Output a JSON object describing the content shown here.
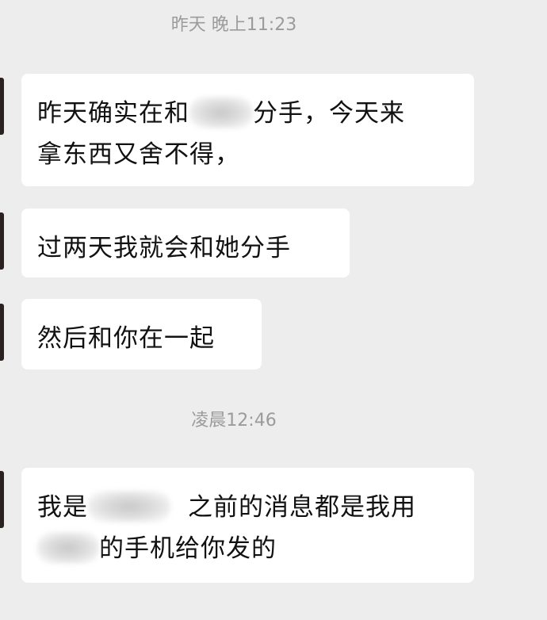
{
  "chat": {
    "time_yesterday": "昨天 晚上11:23",
    "time_early_morning": "凌晨12:46",
    "messages": [
      {
        "line1_before": "昨天确实在和",
        "line1_after": "分手，今天来",
        "line2": "拿东西又舍不得，"
      },
      {
        "text": "过两天我就会和她分手"
      },
      {
        "text": "然后和你在一起"
      },
      {
        "line1_before": "我是",
        "line1_after": "之前的消息都是我用",
        "line2_after": "的手机给你发的"
      }
    ]
  }
}
